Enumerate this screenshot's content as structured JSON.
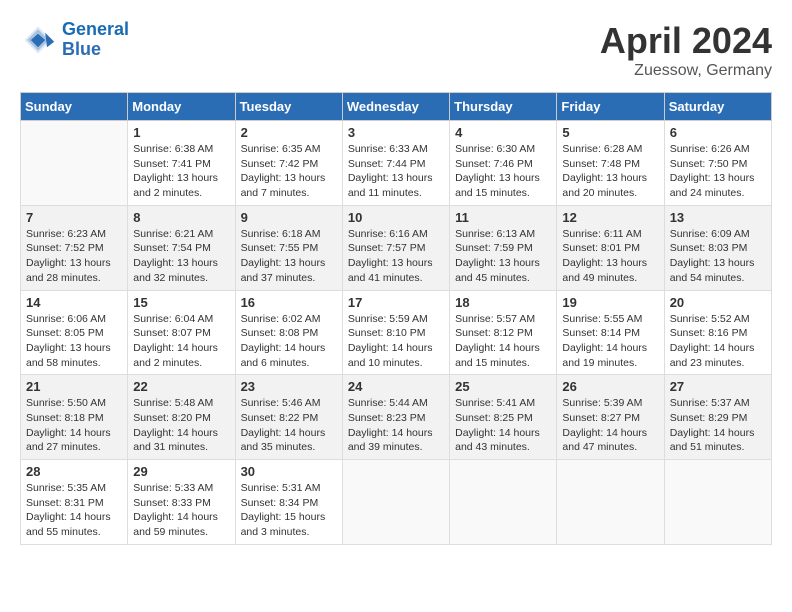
{
  "header": {
    "logo_line1": "General",
    "logo_line2": "Blue",
    "month_title": "April 2024",
    "subtitle": "Zuessow, Germany"
  },
  "weekdays": [
    "Sunday",
    "Monday",
    "Tuesday",
    "Wednesday",
    "Thursday",
    "Friday",
    "Saturday"
  ],
  "weeks": [
    [
      {
        "day": "",
        "sunrise": "",
        "sunset": "",
        "daylight": ""
      },
      {
        "day": "1",
        "sunrise": "Sunrise: 6:38 AM",
        "sunset": "Sunset: 7:41 PM",
        "daylight": "Daylight: 13 hours and 2 minutes."
      },
      {
        "day": "2",
        "sunrise": "Sunrise: 6:35 AM",
        "sunset": "Sunset: 7:42 PM",
        "daylight": "Daylight: 13 hours and 7 minutes."
      },
      {
        "day": "3",
        "sunrise": "Sunrise: 6:33 AM",
        "sunset": "Sunset: 7:44 PM",
        "daylight": "Daylight: 13 hours and 11 minutes."
      },
      {
        "day": "4",
        "sunrise": "Sunrise: 6:30 AM",
        "sunset": "Sunset: 7:46 PM",
        "daylight": "Daylight: 13 hours and 15 minutes."
      },
      {
        "day": "5",
        "sunrise": "Sunrise: 6:28 AM",
        "sunset": "Sunset: 7:48 PM",
        "daylight": "Daylight: 13 hours and 20 minutes."
      },
      {
        "day": "6",
        "sunrise": "Sunrise: 6:26 AM",
        "sunset": "Sunset: 7:50 PM",
        "daylight": "Daylight: 13 hours and 24 minutes."
      }
    ],
    [
      {
        "day": "7",
        "sunrise": "Sunrise: 6:23 AM",
        "sunset": "Sunset: 7:52 PM",
        "daylight": "Daylight: 13 hours and 28 minutes."
      },
      {
        "day": "8",
        "sunrise": "Sunrise: 6:21 AM",
        "sunset": "Sunset: 7:54 PM",
        "daylight": "Daylight: 13 hours and 32 minutes."
      },
      {
        "day": "9",
        "sunrise": "Sunrise: 6:18 AM",
        "sunset": "Sunset: 7:55 PM",
        "daylight": "Daylight: 13 hours and 37 minutes."
      },
      {
        "day": "10",
        "sunrise": "Sunrise: 6:16 AM",
        "sunset": "Sunset: 7:57 PM",
        "daylight": "Daylight: 13 hours and 41 minutes."
      },
      {
        "day": "11",
        "sunrise": "Sunrise: 6:13 AM",
        "sunset": "Sunset: 7:59 PM",
        "daylight": "Daylight: 13 hours and 45 minutes."
      },
      {
        "day": "12",
        "sunrise": "Sunrise: 6:11 AM",
        "sunset": "Sunset: 8:01 PM",
        "daylight": "Daylight: 13 hours and 49 minutes."
      },
      {
        "day": "13",
        "sunrise": "Sunrise: 6:09 AM",
        "sunset": "Sunset: 8:03 PM",
        "daylight": "Daylight: 13 hours and 54 minutes."
      }
    ],
    [
      {
        "day": "14",
        "sunrise": "Sunrise: 6:06 AM",
        "sunset": "Sunset: 8:05 PM",
        "daylight": "Daylight: 13 hours and 58 minutes."
      },
      {
        "day": "15",
        "sunrise": "Sunrise: 6:04 AM",
        "sunset": "Sunset: 8:07 PM",
        "daylight": "Daylight: 14 hours and 2 minutes."
      },
      {
        "day": "16",
        "sunrise": "Sunrise: 6:02 AM",
        "sunset": "Sunset: 8:08 PM",
        "daylight": "Daylight: 14 hours and 6 minutes."
      },
      {
        "day": "17",
        "sunrise": "Sunrise: 5:59 AM",
        "sunset": "Sunset: 8:10 PM",
        "daylight": "Daylight: 14 hours and 10 minutes."
      },
      {
        "day": "18",
        "sunrise": "Sunrise: 5:57 AM",
        "sunset": "Sunset: 8:12 PM",
        "daylight": "Daylight: 14 hours and 15 minutes."
      },
      {
        "day": "19",
        "sunrise": "Sunrise: 5:55 AM",
        "sunset": "Sunset: 8:14 PM",
        "daylight": "Daylight: 14 hours and 19 minutes."
      },
      {
        "day": "20",
        "sunrise": "Sunrise: 5:52 AM",
        "sunset": "Sunset: 8:16 PM",
        "daylight": "Daylight: 14 hours and 23 minutes."
      }
    ],
    [
      {
        "day": "21",
        "sunrise": "Sunrise: 5:50 AM",
        "sunset": "Sunset: 8:18 PM",
        "daylight": "Daylight: 14 hours and 27 minutes."
      },
      {
        "day": "22",
        "sunrise": "Sunrise: 5:48 AM",
        "sunset": "Sunset: 8:20 PM",
        "daylight": "Daylight: 14 hours and 31 minutes."
      },
      {
        "day": "23",
        "sunrise": "Sunrise: 5:46 AM",
        "sunset": "Sunset: 8:22 PM",
        "daylight": "Daylight: 14 hours and 35 minutes."
      },
      {
        "day": "24",
        "sunrise": "Sunrise: 5:44 AM",
        "sunset": "Sunset: 8:23 PM",
        "daylight": "Daylight: 14 hours and 39 minutes."
      },
      {
        "day": "25",
        "sunrise": "Sunrise: 5:41 AM",
        "sunset": "Sunset: 8:25 PM",
        "daylight": "Daylight: 14 hours and 43 minutes."
      },
      {
        "day": "26",
        "sunrise": "Sunrise: 5:39 AM",
        "sunset": "Sunset: 8:27 PM",
        "daylight": "Daylight: 14 hours and 47 minutes."
      },
      {
        "day": "27",
        "sunrise": "Sunrise: 5:37 AM",
        "sunset": "Sunset: 8:29 PM",
        "daylight": "Daylight: 14 hours and 51 minutes."
      }
    ],
    [
      {
        "day": "28",
        "sunrise": "Sunrise: 5:35 AM",
        "sunset": "Sunset: 8:31 PM",
        "daylight": "Daylight: 14 hours and 55 minutes."
      },
      {
        "day": "29",
        "sunrise": "Sunrise: 5:33 AM",
        "sunset": "Sunset: 8:33 PM",
        "daylight": "Daylight: 14 hours and 59 minutes."
      },
      {
        "day": "30",
        "sunrise": "Sunrise: 5:31 AM",
        "sunset": "Sunset: 8:34 PM",
        "daylight": "Daylight: 15 hours and 3 minutes."
      },
      {
        "day": "",
        "sunrise": "",
        "sunset": "",
        "daylight": ""
      },
      {
        "day": "",
        "sunrise": "",
        "sunset": "",
        "daylight": ""
      },
      {
        "day": "",
        "sunrise": "",
        "sunset": "",
        "daylight": ""
      },
      {
        "day": "",
        "sunrise": "",
        "sunset": "",
        "daylight": ""
      }
    ]
  ]
}
